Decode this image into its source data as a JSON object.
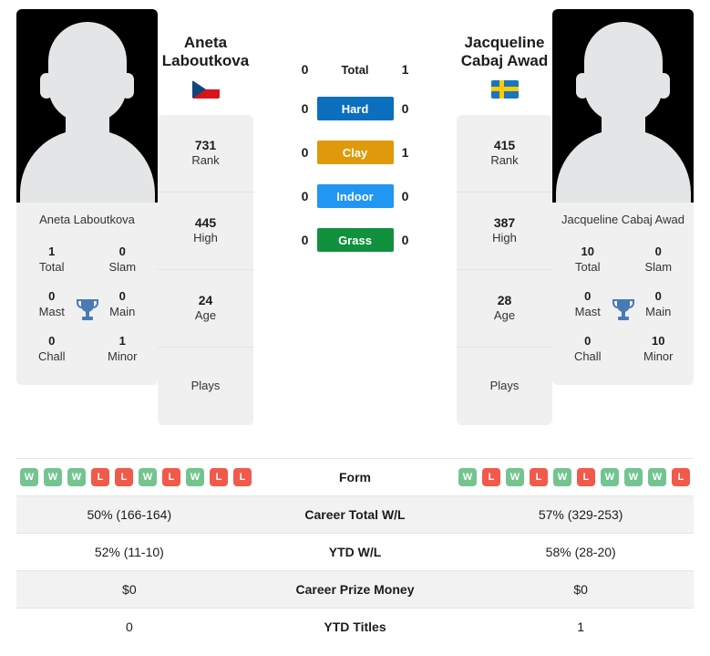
{
  "players": {
    "left": {
      "name": "Aneta Laboutkova",
      "name_line1": "Aneta",
      "name_line2": "Laboutkova",
      "flag": "czech-republic-flag",
      "titles": [
        {
          "value": "1",
          "label": "Total"
        },
        {
          "value": "0",
          "label": "Slam"
        },
        {
          "value": "0",
          "label": "Mast"
        },
        {
          "value": "0",
          "label": "Main"
        },
        {
          "value": "0",
          "label": "Chall"
        },
        {
          "value": "1",
          "label": "Minor"
        }
      ],
      "stats": [
        {
          "value": "731",
          "label": "Rank"
        },
        {
          "value": "445",
          "label": "High"
        },
        {
          "value": "24",
          "label": "Age"
        },
        {
          "value": "",
          "label": "Plays"
        }
      ],
      "form": [
        "W",
        "W",
        "W",
        "L",
        "L",
        "W",
        "L",
        "W",
        "L",
        "L"
      ],
      "career_total_wl": "50% (166-164)",
      "ytd_wl": "52% (11-10)",
      "career_prize_money": "$0",
      "ytd_titles": "0"
    },
    "right": {
      "name": "Jacqueline Cabaj Awad",
      "name_line1": "Jacqueline",
      "name_line2": "Cabaj Awad",
      "flag": "sweden-flag",
      "titles": [
        {
          "value": "10",
          "label": "Total"
        },
        {
          "value": "0",
          "label": "Slam"
        },
        {
          "value": "0",
          "label": "Mast"
        },
        {
          "value": "0",
          "label": "Main"
        },
        {
          "value": "0",
          "label": "Chall"
        },
        {
          "value": "10",
          "label": "Minor"
        }
      ],
      "stats": [
        {
          "value": "415",
          "label": "Rank"
        },
        {
          "value": "387",
          "label": "High"
        },
        {
          "value": "28",
          "label": "Age"
        },
        {
          "value": "",
          "label": "Plays"
        }
      ],
      "form": [
        "W",
        "L",
        "W",
        "L",
        "W",
        "L",
        "W",
        "W",
        "W",
        "L"
      ],
      "career_total_wl": "57% (329-253)",
      "ytd_wl": "58% (28-20)",
      "career_prize_money": "$0",
      "ytd_titles": "1"
    }
  },
  "head_to_head": [
    {
      "label": "Total",
      "left": "0",
      "right": "1",
      "color": "",
      "style": "plain"
    },
    {
      "label": "Hard",
      "left": "0",
      "right": "0",
      "color": "#0b6fbd",
      "style": "bar"
    },
    {
      "label": "Clay",
      "left": "0",
      "right": "1",
      "color": "#de9a0a",
      "style": "bar"
    },
    {
      "label": "Indoor",
      "left": "0",
      "right": "0",
      "color": "#2196f3",
      "style": "bar"
    },
    {
      "label": "Grass",
      "left": "0",
      "right": "0",
      "color": "#11913d",
      "style": "bar"
    }
  ],
  "comparison_rows": [
    {
      "label": "Form",
      "key": "form",
      "type": "form"
    },
    {
      "label": "Career Total W/L",
      "key": "career_total_wl",
      "type": "text"
    },
    {
      "label": "YTD W/L",
      "key": "ytd_wl",
      "type": "text"
    },
    {
      "label": "Career Prize Money",
      "key": "career_prize_money",
      "type": "text"
    },
    {
      "label": "YTD Titles",
      "key": "ytd_titles",
      "type": "text"
    }
  ],
  "colors": {
    "win_badge": "#74c490",
    "loss_badge": "#f15a4a",
    "panel_bg": "#f0f0f0",
    "row_shade": "#f2f2f2",
    "trophy": "#4a7ab5"
  }
}
